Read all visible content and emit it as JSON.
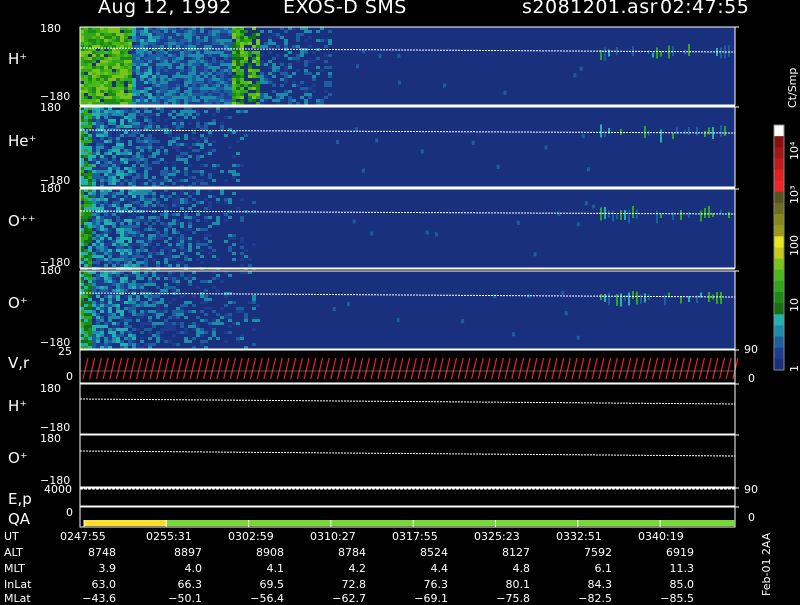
{
  "header": {
    "date": "Aug 12, 1992",
    "instrument": "EXOS-D SMS",
    "file": "s2081201.asr",
    "time": "02:47:55"
  },
  "footer_note": "Feb-01 2AA",
  "colorbar": {
    "unit": "Ct/Smp",
    "ticks": [
      "10⁴",
      "10³",
      "100",
      "10",
      "1"
    ],
    "colors": [
      "#ffffff",
      "#8a0f0f",
      "#a61515",
      "#c01a1a",
      "#e22020",
      "#f02525",
      "#555520",
      "#6d6d1e",
      "#88881a",
      "#9a9a18",
      "#e8e820",
      "#c8c81e",
      "#7ac41c",
      "#4cb81a",
      "#2ea818",
      "#1f8a18",
      "#157015",
      "#22b0b0",
      "#1c8ca8",
      "#1d5ea0",
      "#1e3d90",
      "#18307e"
    ]
  },
  "panels": {
    "H_plus": {
      "label": "H⁺",
      "top_tick": "180",
      "bottom_tick": "−180"
    },
    "He_plus": {
      "label": "He⁺",
      "top_tick": "180",
      "bottom_tick": "−180"
    },
    "O_pp": {
      "label": "O⁺⁺",
      "top_tick": "180",
      "bottom_tick": "−180"
    },
    "O_plus": {
      "label": "O⁺",
      "top_tick": "180",
      "bottom_tick": "−180"
    },
    "Vr": {
      "label": "V,r",
      "left_top": "25",
      "left_bottom": "0",
      "right_top": "90",
      "right_bottom": "0"
    },
    "H_plus_line": {
      "label": "H⁺",
      "top_tick": "180",
      "bottom_tick": "−180"
    },
    "O_plus_line": {
      "label": "O⁺",
      "top_tick": "180",
      "bottom_tick": "−180"
    },
    "Ep": {
      "label": "E,p",
      "left_top": "4000",
      "right_top": "90"
    },
    "QA": {
      "label": "QA",
      "left": "0",
      "right": "0"
    }
  },
  "orbit": {
    "labels": [
      "UT",
      "ALT",
      "MLT",
      "InLat",
      "MLat"
    ],
    "columns": [
      {
        "UT": "0247:55",
        "ALT": "8748",
        "MLT": "3.9",
        "InLat": "63.0",
        "MLat": "−43.6"
      },
      {
        "UT": "0255:31",
        "ALT": "8897",
        "MLT": "4.0",
        "InLat": "66.3",
        "MLat": "−50.1"
      },
      {
        "UT": "0302:59",
        "ALT": "8908",
        "MLT": "4.1",
        "InLat": "69.5",
        "MLat": "−56.4"
      },
      {
        "UT": "0310:27",
        "ALT": "8784",
        "MLT": "4.2",
        "InLat": "72.8",
        "MLat": "−62.7"
      },
      {
        "UT": "0317:55",
        "ALT": "8524",
        "MLT": "4.4",
        "InLat": "76.3",
        "MLat": "−69.1"
      },
      {
        "UT": "0325:23",
        "ALT": "8127",
        "MLT": "4.8",
        "InLat": "80.1",
        "MLat": "−75.8"
      },
      {
        "UT": "0332:51",
        "ALT": "7592",
        "MLT": "6.1",
        "InLat": "84.3",
        "MLat": "−82.5"
      },
      {
        "UT": "0340:19",
        "ALT": "6919",
        "MLT": "11.3",
        "InLat": "85.0",
        "MLat": "−85.5"
      }
    ]
  },
  "chart_data": {
    "type": "heatmap",
    "panels": [
      "H⁺",
      "He⁺",
      "O⁺⁺",
      "O⁺"
    ],
    "y_range": [
      -180,
      180
    ],
    "x_range": [
      "0247:55",
      "0340:19"
    ],
    "quality": [
      {
        "from": "0247:55",
        "to": "0255:31",
        "color": "#ffe030"
      },
      {
        "from": "0255:31",
        "to": "0340:19",
        "color": "#7ad836"
      }
    ]
  }
}
